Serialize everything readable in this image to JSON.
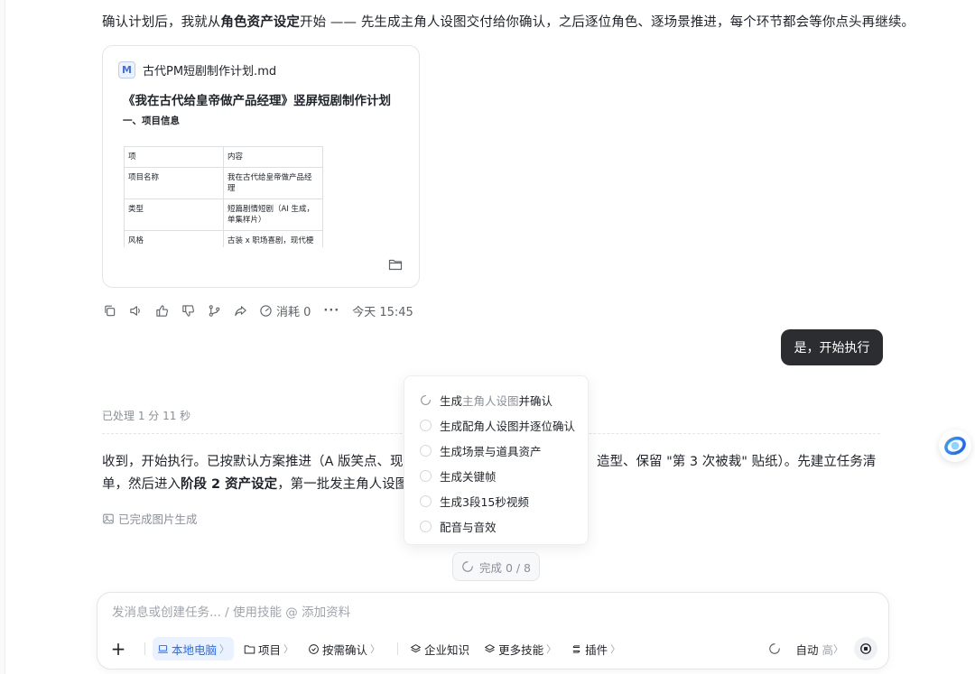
{
  "intro": {
    "before": "确认计划后，我就从",
    "bold": "角色资产设定",
    "after": "开始 —— 先生成主角人设图交付给你确认，之后逐位角色、逐场景推进，每个环节都会等你点头再继续。"
  },
  "file_card": {
    "icon_letter": "M",
    "file_name": "古代PM短剧制作计划.md",
    "doc_title": "《我在古代给皇帝做产品经理》竖屏短剧制作计划",
    "section_heading": "一、项目信息",
    "table": {
      "headers": [
        "项",
        "内容"
      ],
      "rows": [
        [
          "项目名称",
          "我在古代给皇帝做产品经理"
        ],
        [
          "类型",
          "短篇剧情短剧（AI 生成，单集样片）"
        ],
        [
          "风格",
          "古装 x 职场喜剧，现代梗"
        ]
      ]
    }
  },
  "actions": {
    "consume_label": "消耗 0",
    "more": "···",
    "time": "今天 15:45"
  },
  "user_message": "是，开始执行",
  "processed_text": "已处理 1 分 11 秒",
  "reply": {
    "part1": "收到，开始执行。已按默认方案推进（A 版笑点、现代",
    "part2": "造型、保留 \"第 3 次被裁\" 贴纸）。先建立任务清单，然后进入",
    "bold": "阶段 2 资产设定",
    "part3": "，第一批发主角人设图"
  },
  "done_image_label": "已完成图片生成",
  "tasks": [
    {
      "prefix": "生成",
      "dim": "主角人设图",
      "suffix": "并确认",
      "status": "in-progress"
    },
    {
      "prefix": "生成配角人设图并逐位确认",
      "dim": "",
      "suffix": "",
      "status": "pending"
    },
    {
      "prefix": "生成场景与道具资产",
      "dim": "",
      "suffix": "",
      "status": "pending"
    },
    {
      "prefix": "生成关键帧",
      "dim": "",
      "suffix": "",
      "status": "pending"
    },
    {
      "prefix": "生成3段15秒视频",
      "dim": "",
      "suffix": "",
      "status": "pending"
    },
    {
      "prefix": "配音与音效",
      "dim": "",
      "suffix": "",
      "status": "pending"
    }
  ],
  "progress_label": "完成 0 / 8",
  "composer": {
    "placeholder": "发消息或创建任务... / 使用技能 @ 添加资料",
    "plus": "+",
    "tools": {
      "local": "本地电脑",
      "project": "项目",
      "confirm": "按需确认",
      "knowledge": "企业知识",
      "skills": "更多技能",
      "plugins": "插件"
    },
    "auto_label": "自动",
    "auto_level": "高",
    "chevron": "〉"
  },
  "colors": {
    "accent": "#2b6cf0",
    "bubble_bg": "#2b2d31",
    "muted_text": "#8a8f99"
  }
}
